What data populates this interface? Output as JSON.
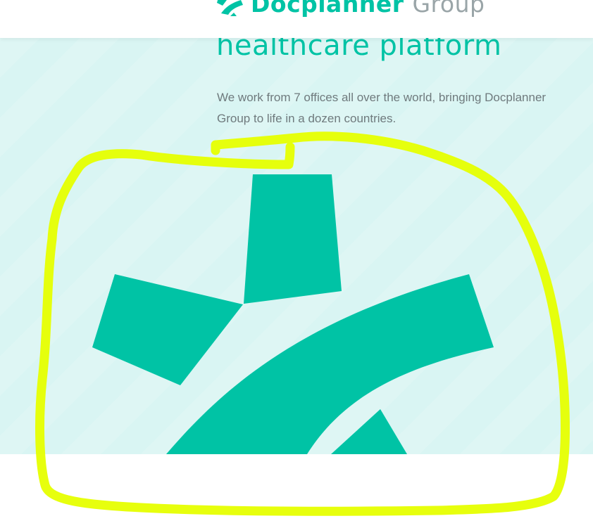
{
  "header": {
    "brand_primary": "Docplanner",
    "brand_secondary": "Group",
    "logo_icon": "docplanner-star-icon"
  },
  "hero": {
    "headline": "healthcare platform",
    "description": "We work from 7 offices all over the world, bringing Docplanner Group to life in a dozen countries.",
    "graphic_icon": "docplanner-star-icon"
  },
  "annotation": {
    "shape": "hand-drawn-circle",
    "color": "#e6ff00"
  },
  "colors": {
    "accent": "#00c3a5",
    "hero_background": "#d9f5f3",
    "text_muted": "#6f7a7d",
    "brand_grey": "#9aa5a8"
  }
}
